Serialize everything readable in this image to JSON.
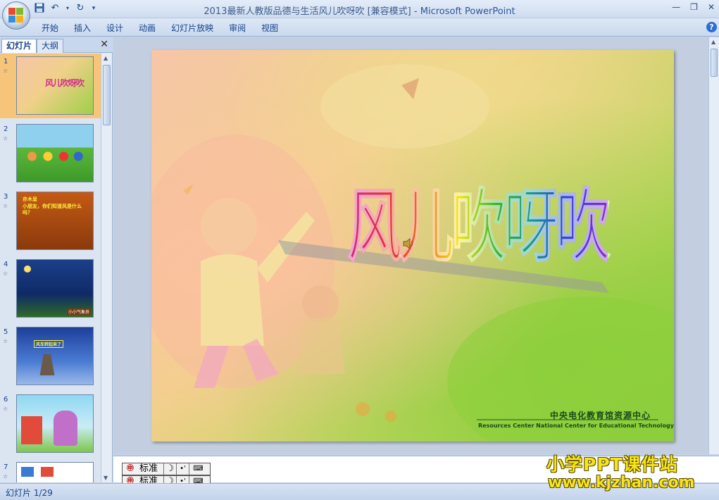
{
  "window": {
    "title_doc": "2013最新人教版品德与生活风儿吹呀吹 [兼容模式]",
    "title_sep": " - ",
    "title_app": "Microsoft PowerPoint"
  },
  "ribbon": {
    "tabs": [
      {
        "label": "开始"
      },
      {
        "label": "插入"
      },
      {
        "label": "设计"
      },
      {
        "label": "动画"
      },
      {
        "label": "幻灯片放映"
      },
      {
        "label": "审阅"
      },
      {
        "label": "视图"
      }
    ],
    "help": "?"
  },
  "left_pane": {
    "tab_slides": "幻灯片",
    "tab_outline": "大纲",
    "close": "✕",
    "slides": [
      {
        "num": "1",
        "anim": "☆",
        "selected": true
      },
      {
        "num": "2",
        "anim": "☆"
      },
      {
        "num": "3",
        "anim": "☆"
      },
      {
        "num": "4",
        "anim": "☆"
      },
      {
        "num": "5",
        "anim": "☆"
      },
      {
        "num": "6",
        "anim": "☆"
      },
      {
        "num": "7",
        "anim": "☆"
      }
    ]
  },
  "slide": {
    "title": "风儿吹呀吹",
    "org_cn": "中央电化教育馆资源中心",
    "org_en": "Resources Center National Center for Educational Technology"
  },
  "thumbs": {
    "t1_title": "风儿吹呀吹",
    "t3_text1": "亦木呈",
    "t3_text2": "小朋友，你们知道风是什么吗？",
    "t4_text": "小小气象员",
    "t5_text": "风车转起来了"
  },
  "ime": {
    "label": "标准",
    "moon": "☽",
    "dots": "•'",
    "keyboard": "⌨"
  },
  "status": {
    "slide_of": "幻灯片 1/29"
  },
  "watermark": {
    "line1": "小学PPT课件站",
    "line2": "www.kjzhan.com"
  },
  "colors": {
    "ribbon_text": "#15428b",
    "selected_slide": "#f7c57a",
    "watermark": "#f7e51c"
  }
}
